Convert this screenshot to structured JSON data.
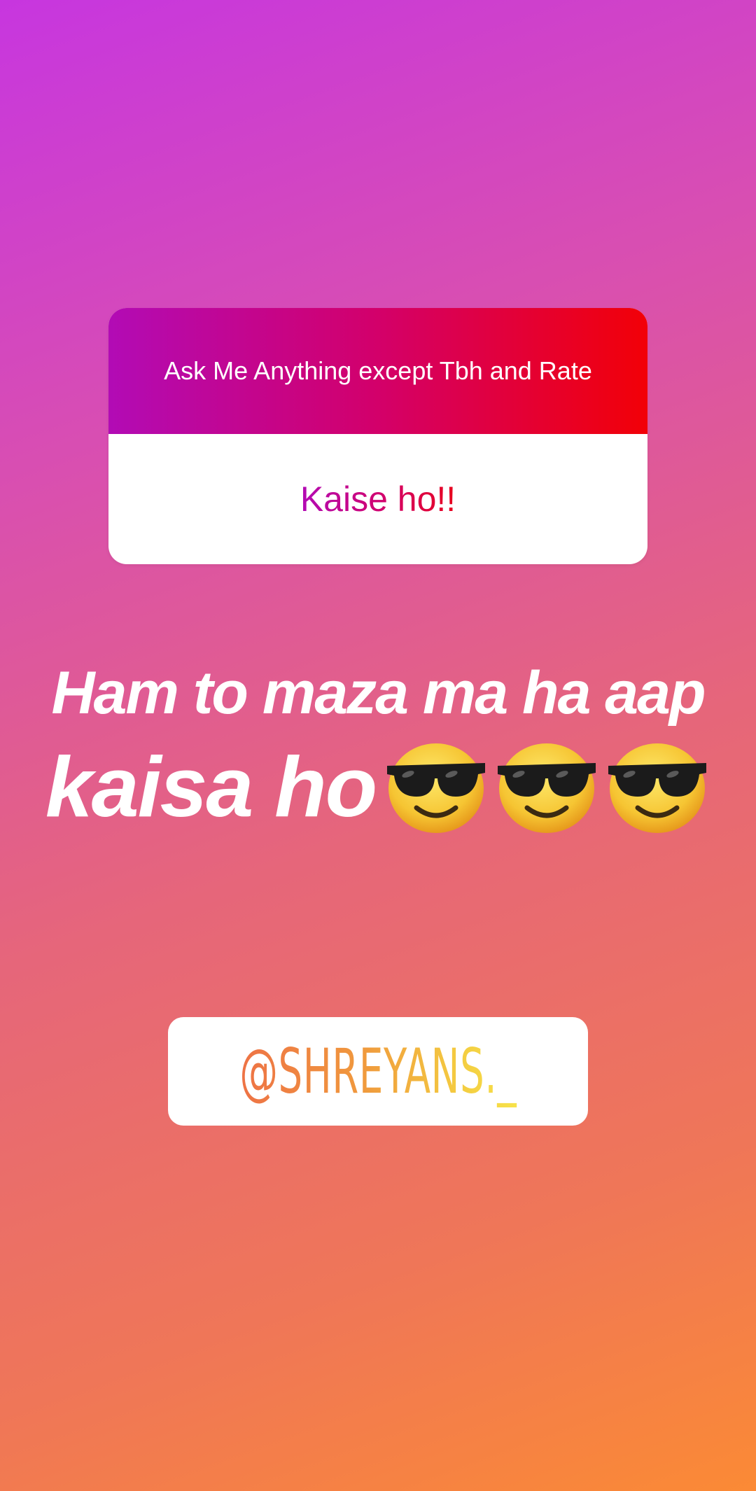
{
  "question_sticker": {
    "prompt": "Ask Me Anything except Tbh and Rate",
    "answer": "Kaise ho!!"
  },
  "reply": {
    "line1": "Ham to maza ma ha aap",
    "line2": "kaisa ho",
    "emoji": "smiling-face-with-sunglasses-icon"
  },
  "mention": {
    "username": "@SHREYANS._"
  },
  "colors": {
    "background_top": "#c736df",
    "background_bottom": "#fb8a35",
    "question_gradient_start": "#b20bb5",
    "question_gradient_end": "#f20007",
    "mention_gradient_start": "#ee7245",
    "mention_gradient_end": "#f7e24a"
  }
}
